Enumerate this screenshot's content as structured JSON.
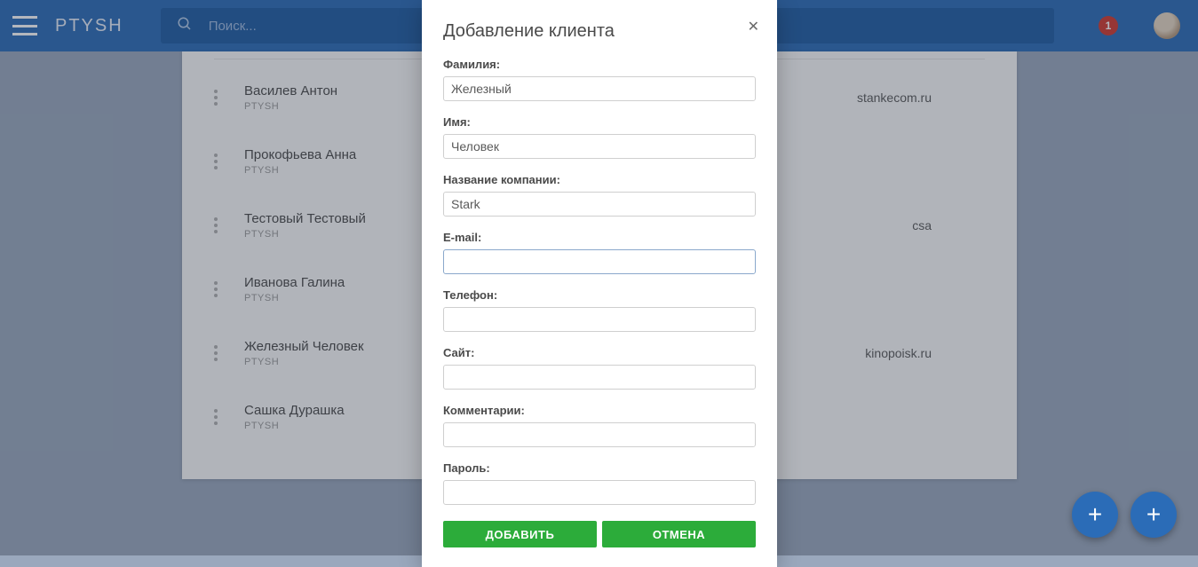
{
  "header": {
    "brand": "PTYSH",
    "search_placeholder": "Поиск...",
    "badge_count": "1"
  },
  "list": {
    "items": [
      {
        "name": "Василев Антон",
        "sub": "PTYSH",
        "right": "stankecom.ru"
      },
      {
        "name": "Прокофьева Анна",
        "sub": "PTYSH",
        "right": ""
      },
      {
        "name": "Тестовый Тестовый",
        "sub": "PTYSH",
        "right": "csa"
      },
      {
        "name": "Иванова Галина",
        "sub": "PTYSH",
        "right": ""
      },
      {
        "name": "Железный Человек",
        "sub": "PTYSH",
        "right": "kinopoisk.ru"
      },
      {
        "name": "Сашка Дурашка",
        "sub": "PTYSH",
        "right": ""
      }
    ]
  },
  "modal": {
    "title": "Добавление клиента",
    "labels": {
      "lastname": "Фамилия:",
      "firstname": "Имя:",
      "company": "Название компании:",
      "email": "E-mail:",
      "phone": "Телефон:",
      "site": "Сайт:",
      "comments": "Комментарии:",
      "password": "Пароль:"
    },
    "values": {
      "lastname": "Железный",
      "firstname": "Человек",
      "company": "Stark",
      "email": "",
      "phone": "",
      "site": "",
      "comments": "",
      "password": ""
    },
    "buttons": {
      "add": "ДОБАВИТЬ",
      "cancel": "ОТМЕНА"
    }
  },
  "fab": {
    "plus": "+"
  }
}
